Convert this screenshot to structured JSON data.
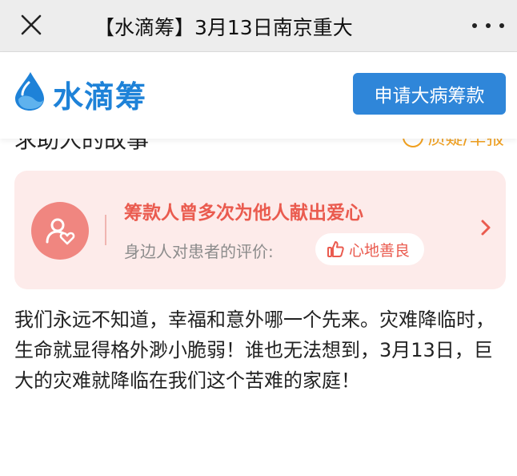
{
  "topbar": {
    "title": "【水滴筹】3月13日南京重大",
    "close_icon": "close-icon",
    "more_icon": "more-dots-icon"
  },
  "header": {
    "logo_text": "水滴筹",
    "logo_icon": "water-drop-icon",
    "apply_button": "申请大病筹款",
    "brand_color": "#1e82d8",
    "button_color": "#2f86d9"
  },
  "section_cut": {
    "left_text": "求助人的故事",
    "right_text": "质疑/举报"
  },
  "endorsement_card": {
    "title": "筹款人曾多次为他人献出爱心",
    "label": "身边人对患者的评价:",
    "tag": "心地善良",
    "tag_icon": "thumbs-up-icon",
    "avatar_icon": "person-heart-icon",
    "accent_color": "#ea5b4f",
    "background_color": "#fdebea"
  },
  "story": {
    "text": "我们永远不知道，幸福和意外哪一个先来。灾难降临时，生命就显得格外渺小脆弱！谁也无法想到，3月13日，巨大的灾难就降临在我们这个苦难的家庭！"
  }
}
